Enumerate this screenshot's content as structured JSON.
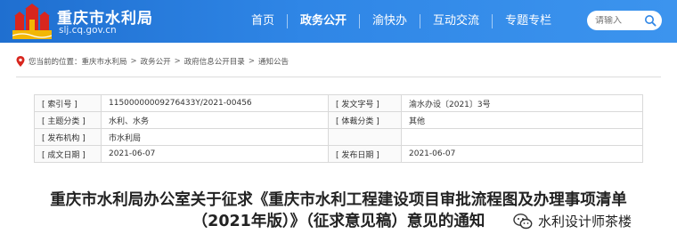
{
  "header": {
    "site_title": "重庆市水利局",
    "site_domain": "slj.cq.gov.cn",
    "nav": [
      {
        "label": "首页"
      },
      {
        "label": "政务公开"
      },
      {
        "label": "渝快办"
      },
      {
        "label": "互动交流"
      },
      {
        "label": "专题专栏"
      }
    ],
    "search_placeholder": "请输入"
  },
  "breadcrumb": {
    "prefix": "您当前的位置：",
    "items": [
      "重庆市水利局",
      "政务公开",
      "政府信息公开目录",
      "通知公告"
    ],
    "separator": ">"
  },
  "info": {
    "index_label": "[ 索引号 ]",
    "index_value": "11500000009276433Y/2021-00456",
    "doc_no_label": "[ 发文字号 ]",
    "doc_no_value": "渝水办设〔2021〕3号",
    "topic_label": "[ 主题分类 ]",
    "topic_value": "水利、水务",
    "genre_label": "[ 体裁分类 ]",
    "genre_value": "其他",
    "org_label": "[ 发布机构 ]",
    "org_value": "市水利局",
    "created_label": "[ 成文日期 ]",
    "created_value": "2021-06-07",
    "published_label": "[ 发布日期 ]",
    "published_value": "2021-06-07"
  },
  "article": {
    "title_line1": "重庆市水利局办公室关于征求《重庆市水利工程建设项目审批流程图及办理事项清单",
    "title_line2": "（2021年版）》（征求意见稿）意见的通知"
  },
  "watermark": {
    "text": "水利设计师茶楼"
  },
  "colors": {
    "header_blue": "#2f86e6",
    "logo_red": "#d8261e",
    "logo_gold": "#f2b705"
  }
}
